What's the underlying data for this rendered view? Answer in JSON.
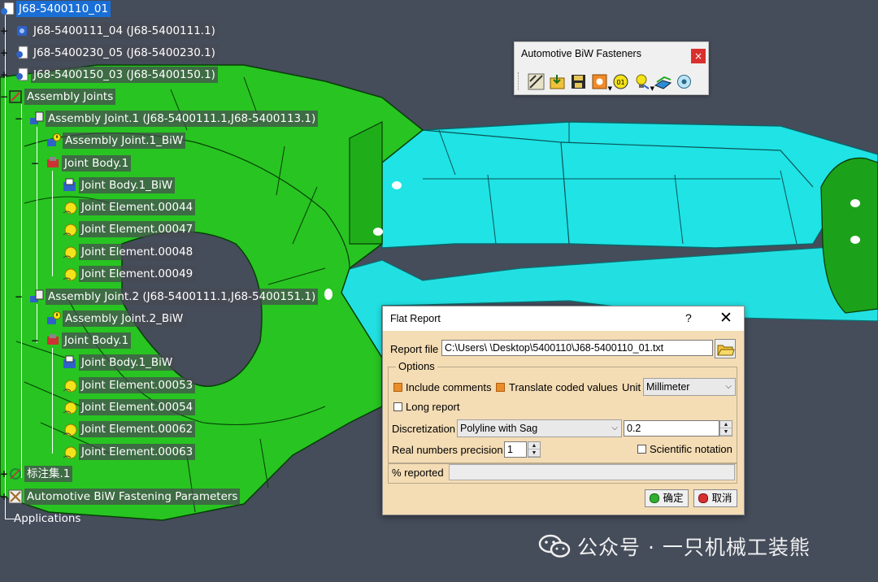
{
  "tree": {
    "root": "J68-5400110_01",
    "nodes": [
      {
        "id": "n1",
        "label": "J68-5400111_04 (J68-5400111.1)",
        "icon": "product-icon"
      },
      {
        "id": "n2",
        "label": "J68-5400230_05 (J68-5400230.1)",
        "icon": "product-icon"
      },
      {
        "id": "n3",
        "label": "J68-5400150_03 (J68-5400150.1)",
        "icon": "product-icon"
      },
      {
        "id": "n4",
        "label": "Assembly Joints",
        "icon": "joints-set-icon"
      },
      {
        "id": "n5",
        "label": "Assembly Joint.1 (J68-5400111.1,J68-5400113.1)",
        "icon": "assembly-joint-icon"
      },
      {
        "id": "n6",
        "label": "Assembly Joint.1_BiW",
        "icon": "warning-joint-icon"
      },
      {
        "id": "n7",
        "label": "Joint Body.1",
        "icon": "joint-body-icon"
      },
      {
        "id": "n8",
        "label": "Joint Body.1_BiW",
        "icon": "joint-body-biw-icon"
      },
      {
        "id": "n9",
        "label": "Joint Element.00044",
        "icon": "joint-element-icon"
      },
      {
        "id": "n10",
        "label": "Joint Element.00047",
        "icon": "joint-element-icon"
      },
      {
        "id": "n11",
        "label": "Joint Element.00048",
        "icon": "joint-element-icon"
      },
      {
        "id": "n12",
        "label": "Joint Element.00049",
        "icon": "joint-element-icon"
      },
      {
        "id": "n13",
        "label": "Assembly Joint.2 (J68-5400111.1,J68-5400151.1)",
        "icon": "assembly-joint-icon"
      },
      {
        "id": "n14",
        "label": "Assembly Joint.2_BiW",
        "icon": "warning-joint-icon"
      },
      {
        "id": "n15",
        "label": "Joint Body.1",
        "icon": "joint-body-icon"
      },
      {
        "id": "n16",
        "label": "Joint Body.1_BiW",
        "icon": "joint-body-biw-icon"
      },
      {
        "id": "n17",
        "label": "Joint Element.00053",
        "icon": "joint-element-icon"
      },
      {
        "id": "n18",
        "label": "Joint Element.00054",
        "icon": "joint-element-icon"
      },
      {
        "id": "n19",
        "label": "Joint Element.00062",
        "icon": "joint-element-icon"
      },
      {
        "id": "n20",
        "label": "Joint Element.00063",
        "icon": "joint-element-icon"
      },
      {
        "id": "n21",
        "label": "标注集.1",
        "icon": "annotation-set-icon"
      },
      {
        "id": "n22",
        "label": "Automotive BiW Fastening Parameters",
        "icon": "fastening-parameters-icon"
      },
      {
        "id": "n23",
        "label": "Applications",
        "icon": ""
      }
    ]
  },
  "toolbar": {
    "title": "Automotive BiW Fasteners",
    "close": "×",
    "buttons": [
      "fastener-icon",
      "import-icon",
      "save-icon",
      "report-icon",
      "numbering-icon",
      "lightbulb-icon",
      "surface-icon",
      "fastener-review-icon"
    ]
  },
  "dialog": {
    "title": "Flat Report",
    "help": "?",
    "close": "✕",
    "report_file_label": "Report file",
    "report_file_value": "C:\\Users\\      \\Desktop\\5400110\\J68-5400110_01.txt",
    "options_label": "Options",
    "include_comments": {
      "label": "Include comments",
      "checked": true
    },
    "translate_coded": {
      "label": "Translate coded values",
      "checked": true
    },
    "unit_label": "Unit",
    "unit_value": "Millimeter",
    "long_report": {
      "label": "Long report",
      "checked": false
    },
    "discretization_label": "Discretization",
    "discretization_value": "Polyline with Sag",
    "sag_value": "0.2",
    "precision_label": "Real numbers precision",
    "precision_value": "1",
    "scientific": {
      "label": "Scientific notation",
      "checked": false
    },
    "reported_label": "% reported",
    "reported_value": "",
    "ok_label": "确定",
    "cancel_label": "取消"
  },
  "watermark": "公众号 · 一只机械工装熊",
  "colors": {
    "background": "#454c5a",
    "green_part": "#22b41a",
    "cyan_part": "#1ee4e6",
    "dialog_bg": "#f4dcb4",
    "selection": "#1a6fd6"
  }
}
